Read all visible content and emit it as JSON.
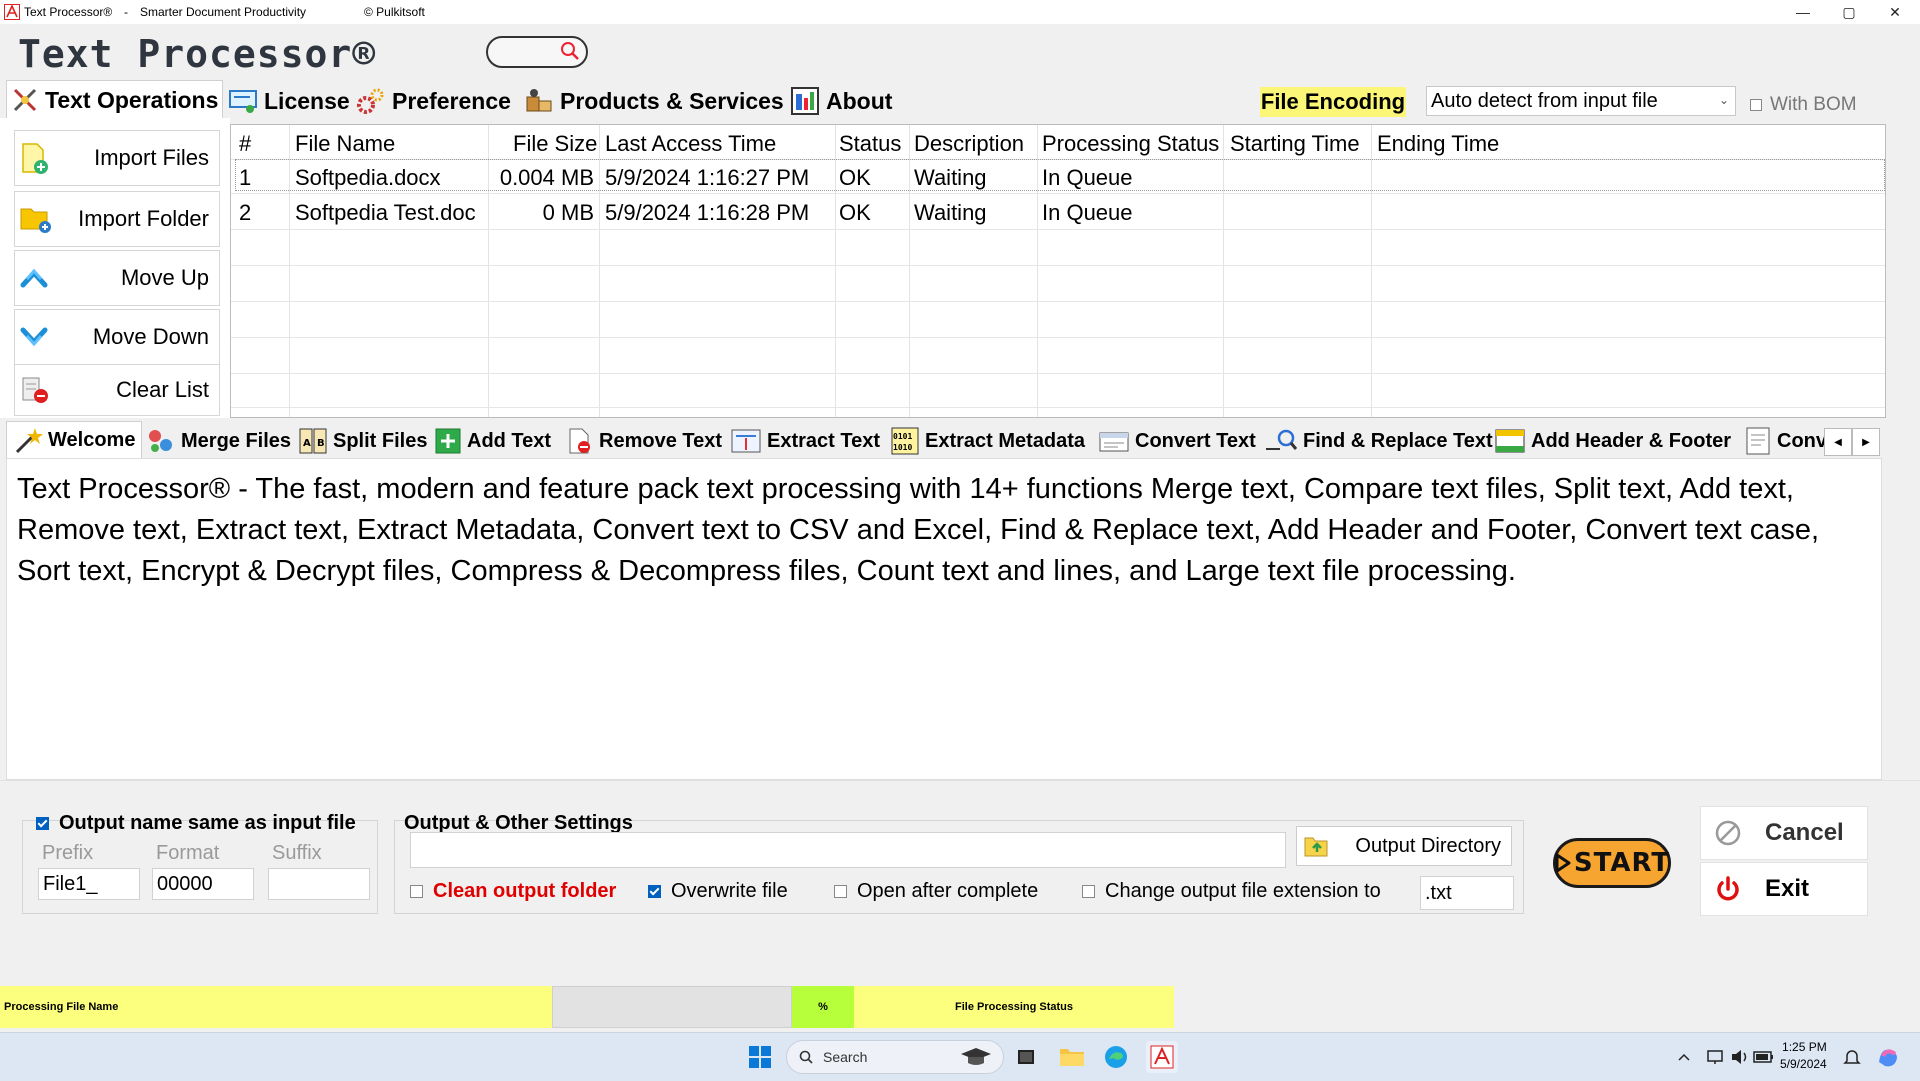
{
  "titlebar": {
    "app_name": "Text Processor®",
    "separator": "-",
    "tagline": "Smarter Document Productivity",
    "copyright": "© Pulkitsoft",
    "minimize": "—",
    "maximize": "▢",
    "close": "✕"
  },
  "header": {
    "title": "Text Processor®"
  },
  "main_tabs": [
    {
      "label": "Text Operations",
      "icon": "tools-icon"
    },
    {
      "label": "License",
      "icon": "certificate-icon"
    },
    {
      "label": "Preference",
      "icon": "gears-icon"
    },
    {
      "label": "Products & Services",
      "icon": "products-icon"
    },
    {
      "label": "About",
      "icon": "info-icon"
    }
  ],
  "encoding": {
    "label": "File Encoding",
    "selected": "Auto detect from input file",
    "with_bom_label": "With BOM",
    "with_bom_checked": false
  },
  "sidebar": {
    "items": [
      {
        "label": "Import Files",
        "icon": "import-files-icon"
      },
      {
        "label": "Import Folder",
        "icon": "import-folder-icon"
      },
      {
        "label": "Move Up",
        "icon": "arrow-up-icon"
      },
      {
        "label": "Move Down",
        "icon": "arrow-down-icon"
      },
      {
        "label": "Clear List",
        "icon": "clear-list-icon"
      }
    ]
  },
  "grid": {
    "columns": [
      "#",
      "File Name",
      "File Size",
      "Last Access Time",
      "Status",
      "Description",
      "Processing Status",
      "Starting Time",
      "Ending Time"
    ],
    "rows": [
      [
        "1",
        "Softpedia.docx",
        "0.004 MB",
        "5/9/2024 1:16:27 PM",
        "OK",
        "Waiting",
        "In Queue",
        "",
        ""
      ],
      [
        "2",
        "Softpedia Test.doc",
        "0 MB",
        "5/9/2024 1:16:28 PM",
        "OK",
        "Waiting",
        "In Queue",
        "",
        ""
      ]
    ]
  },
  "sub_tabs": [
    {
      "label": "Welcome",
      "icon": "magic-wand-icon"
    },
    {
      "label": "Merge Files",
      "icon": "merge-icon"
    },
    {
      "label": "Split Files",
      "icon": "split-icon"
    },
    {
      "label": "Add Text",
      "icon": "add-text-icon"
    },
    {
      "label": "Remove Text",
      "icon": "remove-text-icon"
    },
    {
      "label": "Extract Text",
      "icon": "extract-text-icon"
    },
    {
      "label": "Extract Metadata",
      "icon": "metadata-icon"
    },
    {
      "label": "Convert Text",
      "icon": "convert-icon"
    },
    {
      "label": "Find & Replace Text",
      "icon": "find-replace-icon"
    },
    {
      "label": "Add Header & Footer",
      "icon": "header-footer-icon"
    },
    {
      "label": "Conv",
      "icon": "convert-case-icon"
    }
  ],
  "welcome": {
    "text": "Text Processor® - The fast, modern and feature pack text processing with 14+ functions Merge text, Compare text files, Split text, Add text, Remove text, Extract text, Extract Metadata, Convert text to CSV and Excel, Find & Replace text, Add Header and Footer, Convert text case, Sort text, Encrypt & Decrypt files, Compress & Decompress files, Count text and lines, and Large text file processing."
  },
  "output_name": {
    "same_as_input_label": "Output name same as input file",
    "same_as_input_checked": true,
    "prefix_label": "Prefix",
    "format_label": "Format",
    "suffix_label": "Suffix",
    "prefix_value": "File1_",
    "format_value": "00000",
    "suffix_value": ""
  },
  "output_settings": {
    "title": "Output & Other Settings",
    "directory_value": "",
    "output_directory_button": "Output Directory",
    "clean_output_label": "Clean output folder",
    "clean_output_checked": false,
    "overwrite_label": "Overwrite file",
    "overwrite_checked": true,
    "open_after_label": "Open after complete",
    "open_after_checked": false,
    "change_ext_label": "Change output file extension to",
    "change_ext_checked": false,
    "extension_value": ".txt"
  },
  "actions": {
    "start": "START",
    "cancel": "Cancel",
    "exit": "Exit"
  },
  "status_strip": {
    "file_name_label": "Processing File Name",
    "percent_label": "%",
    "status_label": "File Processing Status"
  },
  "taskbar": {
    "search_placeholder": "Search",
    "time": "1:25 PM",
    "date": "5/9/2024"
  },
  "colors": {
    "highlight_yellow": "#fbf578",
    "status_yellow": "#fcff7e",
    "status_green": "#b6ff3a",
    "start_orange": "#f7a531",
    "danger_red": "#e00000",
    "check_blue": "#0060c0"
  }
}
